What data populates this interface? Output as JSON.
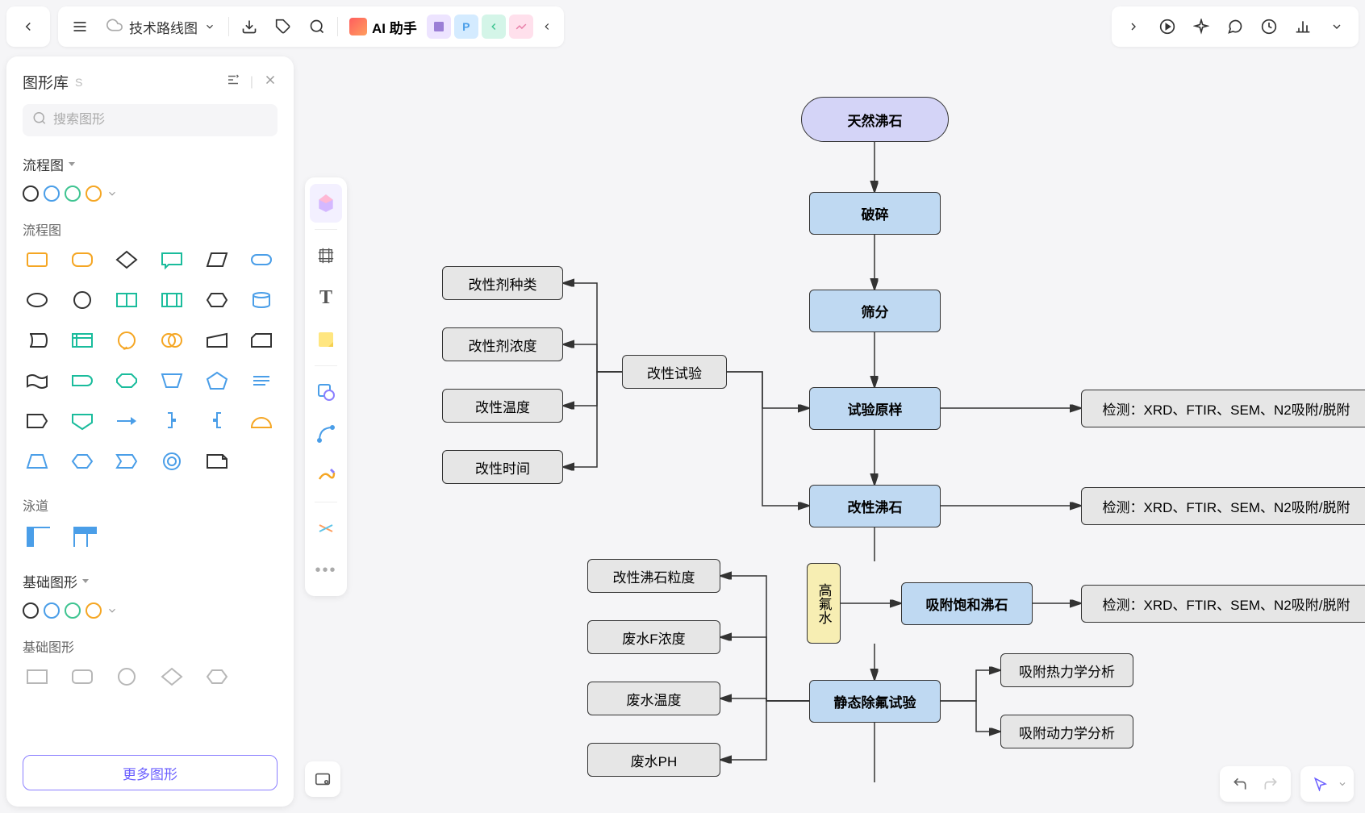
{
  "doc_title": "技术路线图",
  "ai_label": "AI 助手",
  "panel": {
    "title": "图形库",
    "badge": "S",
    "search_placeholder": "搜索图形",
    "more_shapes": "更多图形",
    "sections": {
      "flowchart": "流程图",
      "flowchart_sub": "流程图",
      "swimlane": "泳道",
      "basic": "基础图形",
      "basic_sub": "基础图形"
    }
  },
  "nodes": {
    "start": "天然沸石",
    "crush": "破碎",
    "sieve": "筛分",
    "sample": "试验原样",
    "modified": "改性沸石",
    "saturated": "吸附饱和沸石",
    "static": "静态除氟试验",
    "mod_test": "改性试验",
    "mod_type": "改性剂种类",
    "mod_conc": "改性剂浓度",
    "mod_temp": "改性温度",
    "mod_time": "改性时间",
    "particle": "改性沸石粒度",
    "f_conc": "废水F浓度",
    "w_temp": "废水温度",
    "w_ph": "废水PH",
    "hfwater": "高氟水",
    "detect1": "检测：XRD、FTIR、SEM、N2吸附/脱附",
    "detect2": "检测：XRD、FTIR、SEM、N2吸附/脱附",
    "detect3": "检测：XRD、FTIR、SEM、N2吸附/脱附",
    "thermo": "吸附热力学分析",
    "kinetic": "吸附动力学分析"
  }
}
